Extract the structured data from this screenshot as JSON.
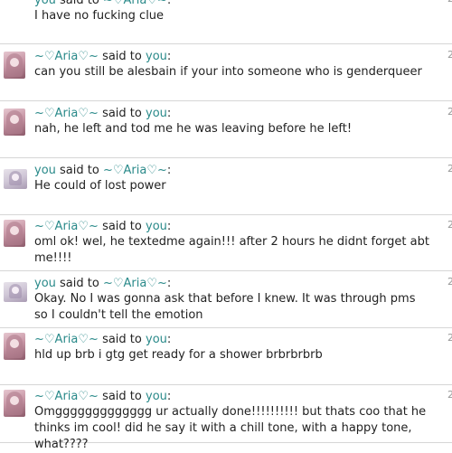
{
  "sep": "said to",
  "colon": ":",
  "edge_marker": "2",
  "messages": [
    {
      "from": "you",
      "to": "~♡Aria♡~",
      "text": "I have no fucking clue"
    },
    {
      "from": "~♡Aria♡~",
      "to": "you",
      "text": "can you still be alesbain if your into someone who is genderqueer"
    },
    {
      "from": "~♡Aria♡~",
      "to": "you",
      "text": "nah, he left and tod me he was leaving before he left!"
    },
    {
      "from": "you",
      "to": "~♡Aria♡~",
      "text": "He could of lost power"
    },
    {
      "from": "~♡Aria♡~",
      "to": "you",
      "text": "oml ok! wel, he textedme again!!! after 2 hours he didnt forget abt me!!!!"
    },
    {
      "from": "you",
      "to": "~♡Aria♡~",
      "text": "Okay. No I was gonna ask that before I knew. It was through pms so I couldn't tell the emotion"
    },
    {
      "from": "~♡Aria♡~",
      "to": "you",
      "text": "hld up brb i gtg get ready for a shower brbrbrbrb"
    },
    {
      "from": "~♡Aria♡~",
      "to": "you",
      "text": "Omggggggggggggg ur actually done!!!!!!!!!! but thats coo that he thinks im cool! did he say it with a chill tone, with a happy tone, what????"
    }
  ]
}
